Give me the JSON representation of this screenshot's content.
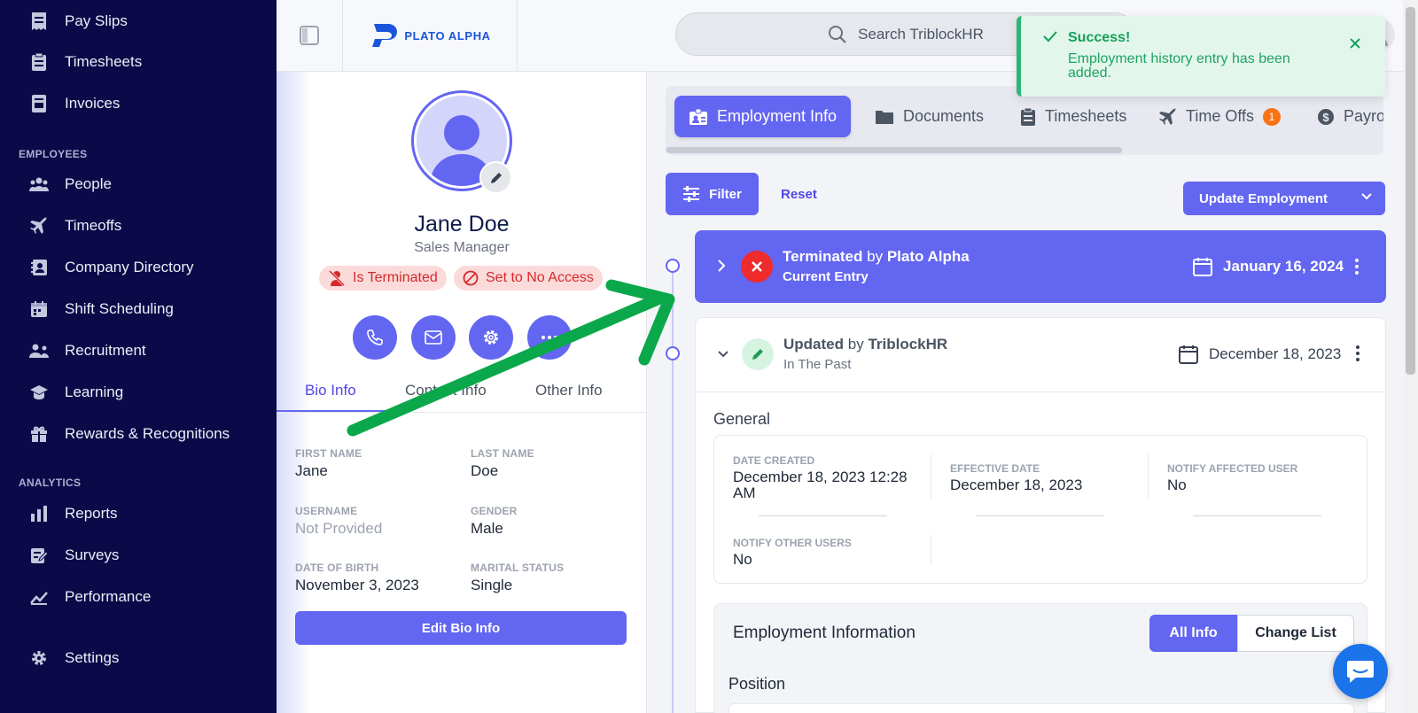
{
  "sidebar": {
    "items_top": [
      {
        "label": "Pay Slips",
        "icon": "pay-slips-icon"
      },
      {
        "label": "Timesheets",
        "icon": "timesheets-icon"
      },
      {
        "label": "Invoices",
        "icon": "invoices-icon"
      }
    ],
    "section_employees": "EMPLOYEES",
    "items_employees": [
      {
        "label": "People",
        "icon": "people-icon"
      },
      {
        "label": "Timeoffs",
        "icon": "plane-icon"
      },
      {
        "label": "Company Directory",
        "icon": "directory-icon"
      },
      {
        "label": "Shift Scheduling",
        "icon": "calendar-icon"
      },
      {
        "label": "Recruitment",
        "icon": "recruitment-icon"
      },
      {
        "label": "Learning",
        "icon": "graduation-cap-icon"
      },
      {
        "label": "Rewards & Recognitions",
        "icon": "gift-icon"
      }
    ],
    "section_analytics": "ANALYTICS",
    "items_analytics": [
      {
        "label": "Reports",
        "icon": "bar-chart-icon"
      },
      {
        "label": "Surveys",
        "icon": "survey-icon"
      },
      {
        "label": "Performance",
        "icon": "line-chart-icon"
      }
    ],
    "settings": "Settings"
  },
  "topbar": {
    "logo_text": "PLATO ALPHA",
    "search_placeholder": "Search TriblockHR"
  },
  "profile": {
    "name": "Jane Doe",
    "role": "Sales Manager",
    "badge_terminated": "Is Terminated",
    "badge_access": "Set to No Access",
    "tabs": [
      "Bio Info",
      "Contact Info",
      "Other Info"
    ],
    "fields": {
      "first_name_label": "FIRST NAME",
      "first_name": "Jane",
      "last_name_label": "LAST NAME",
      "last_name": "Doe",
      "username_label": "USERNAME",
      "username": "Not Provided",
      "gender_label": "GENDER",
      "gender": "Male",
      "dob_label": "DATE OF BIRTH",
      "dob": "November 3, 2023",
      "marital_label": "MARITAL STATUS",
      "marital": "Single"
    },
    "edit_button": "Edit Bio Info"
  },
  "employment_tabs": {
    "employment_info": "Employment Info",
    "documents": "Documents",
    "timesheets": "Timesheets",
    "time_offs": "Time Offs",
    "time_offs_count": "1",
    "payroll": "Payro"
  },
  "toolbar": {
    "filter": "Filter",
    "reset": "Reset",
    "update_employment": "Update Employment"
  },
  "entries": [
    {
      "action": "Terminated",
      "by": "by",
      "actor": "Plato Alpha",
      "sub": "Current Entry",
      "date": "January 16, 2024"
    },
    {
      "action": "Updated",
      "by": "by",
      "actor": "TriblockHR",
      "sub": "In The Past",
      "date": "December 18, 2023"
    }
  ],
  "general": {
    "title": "General",
    "date_created_label": "DATE CREATED",
    "date_created_line1": "December 18, 2023 12:28",
    "date_created_line2": "AM",
    "effective_date_label": "EFFECTIVE DATE",
    "effective_date": "December 18, 2023",
    "notify_affected_label": "NOTIFY AFFECTED USER",
    "notify_affected": "No",
    "notify_other_label": "NOTIFY OTHER USERS",
    "notify_other": "No"
  },
  "employment_information": {
    "title": "Employment Information",
    "all_info": "All Info",
    "change_list": "Change List",
    "position": "Position"
  },
  "toast": {
    "title": "Success!",
    "message": "Employment history entry has been added."
  },
  "colors": {
    "sidebar_bg": "#0c0948",
    "accent": "#6366f1",
    "danger": "#d42a2a",
    "success": "#15a05a",
    "annotation_arrow": "#0aa84a"
  }
}
